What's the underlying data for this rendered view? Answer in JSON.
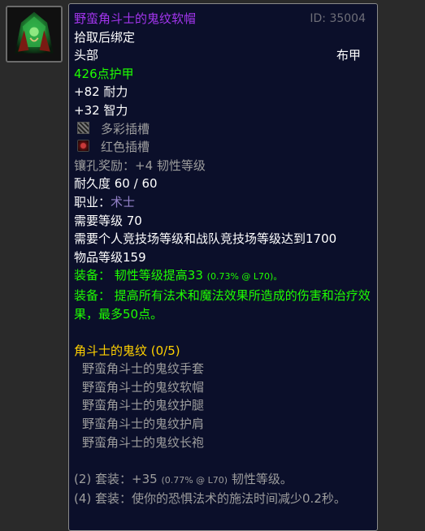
{
  "item": {
    "name": "野蛮角斗士的鬼纹软帽",
    "id_label": "ID: 35004",
    "binding": "拾取后绑定",
    "slot": "头部",
    "armor_type": "布甲",
    "armor": "426点护甲",
    "stats": [
      "+82 耐力",
      "+32 智力"
    ],
    "sockets": [
      {
        "label": "多彩插槽",
        "icon": "prismatic-socket-icon"
      },
      {
        "label": "红色插槽",
        "icon": "red-socket-icon"
      }
    ],
    "socket_bonus": "镶孔奖励：+4 韧性等级",
    "durability": "耐久度 60 / 60",
    "class_label": "职业：",
    "class_value": "术士",
    "required_level": "需要等级 70",
    "arena_requirement": "需要个人竞技场等级和战队竞技场等级达到1700",
    "item_level": "物品等级159",
    "equip1_prefix": "装备：",
    "equip1_text": "韧性等级提高33",
    "equip1_detail": "(0.73% @ L70)。",
    "equip2_prefix": "装备：",
    "equip2_text": "提高所有法术和魔法效果所造成的伤害和治疗效果，最多50点。"
  },
  "set": {
    "name": "角斗士的鬼纹 (0/5)",
    "pieces": [
      "野蛮角斗士的鬼纹手套",
      "野蛮角斗士的鬼纹软帽",
      "野蛮角斗士的鬼纹护腿",
      "野蛮角斗士的鬼纹护肩",
      "野蛮角斗士的鬼纹长袍"
    ],
    "bonus2_prefix": "(2) 套装：+35",
    "bonus2_detail": "(0.77% @ L70)",
    "bonus2_suffix": "韧性等级。",
    "bonus4": "(4) 套装：使你的恐惧法术的施法时间减少0.2秒。"
  },
  "colors": {
    "epic": "#a335ee",
    "green": "#1eff00",
    "grey": "#9d9d9d",
    "warlock": "#9482c9",
    "set_title": "#ffd100"
  }
}
